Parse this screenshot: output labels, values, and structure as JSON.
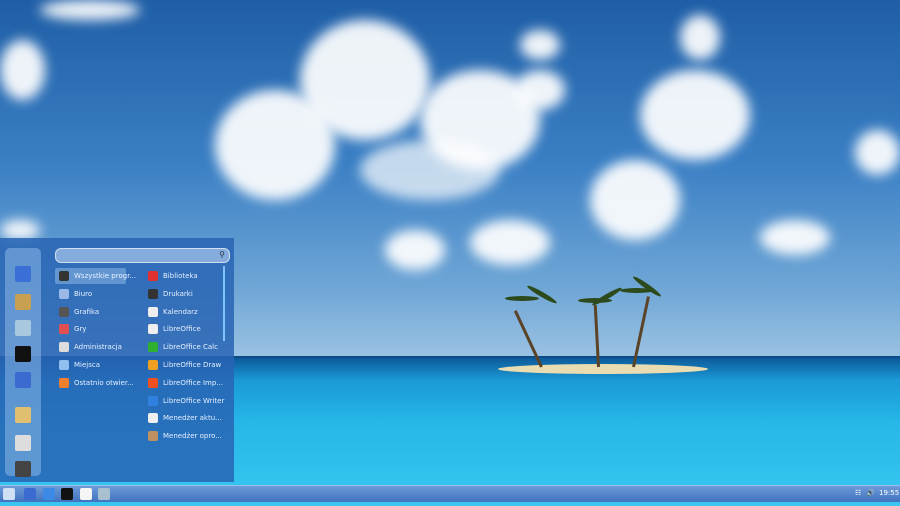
{
  "menu": {
    "search": {
      "value": "",
      "placeholder": ""
    },
    "favorites": [
      {
        "icon": "browser-icon",
        "color": "#3a6fd6"
      },
      {
        "icon": "package-manager-icon",
        "color": "#c8a052"
      },
      {
        "icon": "user-folder-icon",
        "color": "#a8c8e0"
      },
      {
        "icon": "terminal-icon",
        "color": "#111111"
      },
      {
        "icon": "file-manager-icon",
        "color": "#3b6ad0"
      },
      {
        "icon": "lock-screen-icon",
        "color": "#e0c070"
      },
      {
        "icon": "logout-icon",
        "color": "#dddddd"
      },
      {
        "icon": "power-icon",
        "color": "#444444"
      }
    ],
    "categories": [
      {
        "label": "Wszystkie progr...",
        "icon": "grid-icon",
        "color": "#333333",
        "selected": true
      },
      {
        "label": "Biuro",
        "icon": "office-icon",
        "color": "#9ab8e8"
      },
      {
        "label": "Grafika",
        "icon": "graphics-icon",
        "color": "#555555"
      },
      {
        "label": "Gry",
        "icon": "games-icon",
        "color": "#e05050"
      },
      {
        "label": "Administracja",
        "icon": "admin-icon",
        "color": "#dddddd"
      },
      {
        "label": "Miejsca",
        "icon": "places-icon",
        "color": "#8fc0f0"
      },
      {
        "label": "Ostatnio otwier...",
        "icon": "recent-icon",
        "color": "#f08030"
      }
    ],
    "apps": [
      {
        "label": "Biblioteka",
        "icon": "library-icon",
        "color": "#e03030"
      },
      {
        "label": "Drukarki",
        "icon": "printer-icon",
        "color": "#333333"
      },
      {
        "label": "Kalendarz",
        "icon": "calendar-icon",
        "color": "#eeeeee"
      },
      {
        "label": "LibreOffice",
        "icon": "libreoffice-icon",
        "color": "#eeeeee"
      },
      {
        "label": "LibreOffice Calc",
        "icon": "libreoffice-calc-icon",
        "color": "#30b030"
      },
      {
        "label": "LibreOffice Draw",
        "icon": "libreoffice-draw-icon",
        "color": "#f0a020"
      },
      {
        "label": "LibreOffice Imp...",
        "icon": "libreoffice-impress-icon",
        "color": "#f05020"
      },
      {
        "label": "LibreOffice Writer",
        "icon": "libreoffice-writer-icon",
        "color": "#3080e0"
      },
      {
        "label": "Menedżer aktu...",
        "icon": "update-manager-icon",
        "color": "#eeeeee"
      },
      {
        "label": "Menedżer opro...",
        "icon": "software-manager-icon",
        "color": "#c09060"
      }
    ]
  },
  "taskbar": {
    "items": [
      {
        "icon": "menu-icon",
        "color": "#cfe0f5"
      },
      {
        "icon": "file-manager-icon",
        "color": "#3b6ad0"
      },
      {
        "icon": "browser-icon",
        "color": "#3a8ae6"
      },
      {
        "icon": "terminal-icon",
        "color": "#111111"
      },
      {
        "icon": "text-editor-icon",
        "color": "#f5f5f5"
      },
      {
        "icon": "folder-icon",
        "color": "#a8c0d0"
      }
    ],
    "clock": "19:55"
  }
}
